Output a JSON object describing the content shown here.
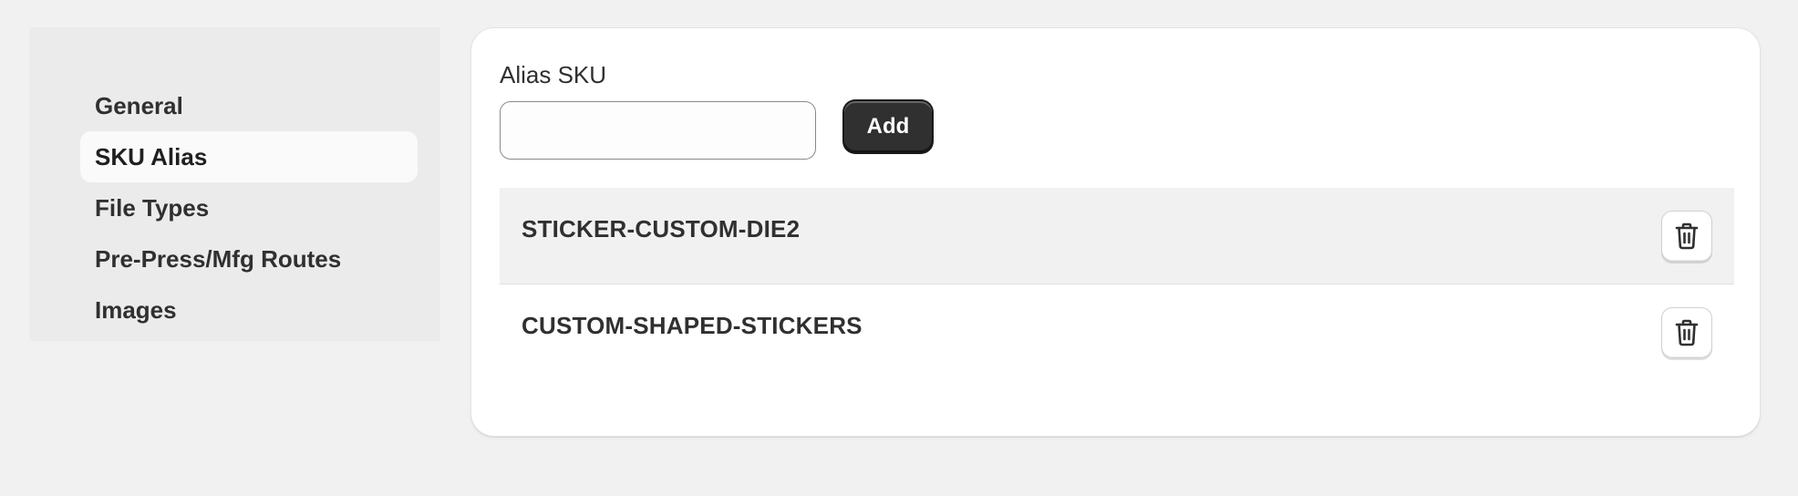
{
  "sidebar": {
    "items": [
      {
        "label": "General",
        "active": false
      },
      {
        "label": "SKU Alias",
        "active": true
      },
      {
        "label": "File Types",
        "active": false
      },
      {
        "label": "Pre-Press/Mfg Routes",
        "active": false
      },
      {
        "label": "Images",
        "active": false
      }
    ]
  },
  "form": {
    "label": "Alias SKU",
    "input_value": "",
    "input_placeholder": "",
    "add_label": "Add"
  },
  "aliases": [
    {
      "name": "STICKER-CUSTOM-DIE2",
      "delete_icon": "trash-icon"
    },
    {
      "name": "CUSTOM-SHAPED-STICKERS",
      "delete_icon": "trash-icon"
    }
  ],
  "colors": {
    "background": "#f1f1f1",
    "sidebar_bg": "#ebebeb",
    "active_item_bg": "#fafafa",
    "primary_button": "#303030",
    "text": "#303030"
  }
}
